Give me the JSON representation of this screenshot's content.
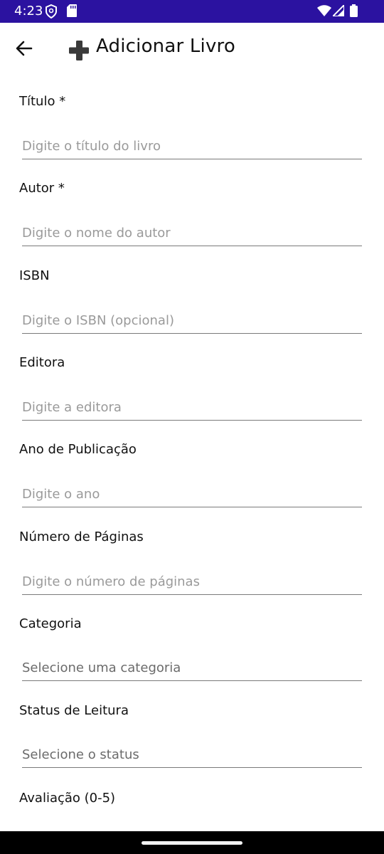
{
  "status_bar": {
    "time": "4:23",
    "left_icons": [
      "shield-icon",
      "sd-card-icon"
    ],
    "right_icons": [
      "wifi-icon",
      "signal-icon",
      "battery-icon"
    ],
    "background": "#2b12a0"
  },
  "header": {
    "back_icon": "arrow-left-icon",
    "title_icon": "plus-icon",
    "title": "Adicionar Livro"
  },
  "fields": [
    {
      "label": "Título *",
      "placeholder": "Digite o título do livro",
      "type": "text"
    },
    {
      "label": "Autor *",
      "placeholder": "Digite o nome do autor",
      "type": "text"
    },
    {
      "label": "ISBN",
      "placeholder": "Digite o ISBN (opcional)",
      "type": "text"
    },
    {
      "label": "Editora",
      "placeholder": "Digite a editora",
      "type": "text"
    },
    {
      "label": "Ano de Publicação",
      "placeholder": "Digite o ano",
      "type": "text"
    },
    {
      "label": "Número de Páginas",
      "placeholder": "Digite o número de páginas",
      "type": "text"
    },
    {
      "label": "Categoria",
      "placeholder": "Selecione uma categoria",
      "type": "select"
    },
    {
      "label": "Status de Leitura",
      "placeholder": "Selecione o status",
      "type": "select"
    },
    {
      "label": "Avaliação (0-5)"
    }
  ]
}
